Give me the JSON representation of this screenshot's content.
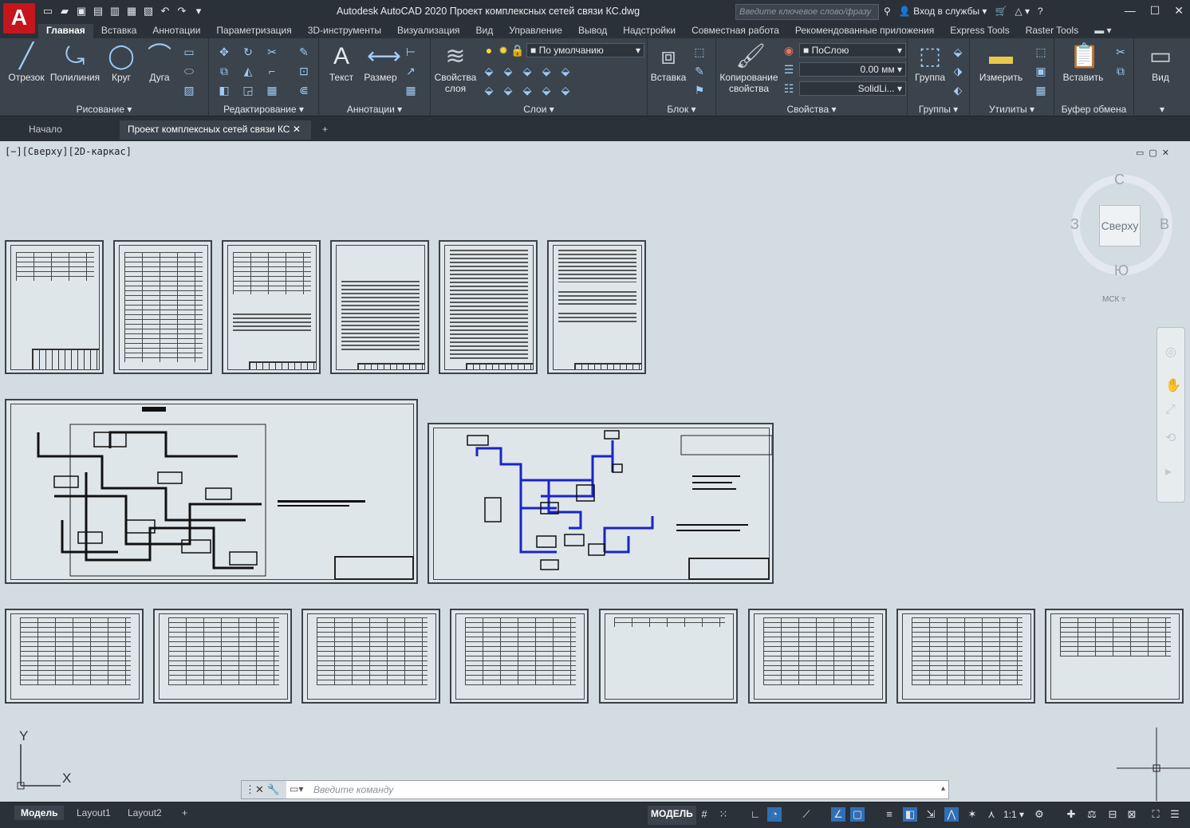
{
  "app": {
    "title": "Autodesk AutoCAD 2020   Проект комплексных сетей связи КС.dwg",
    "logo": "A",
    "search_placeholder": "Введите ключевое слово/фразу",
    "signin": "Вход в службы",
    "help": "?"
  },
  "qat": [
    "new-icon",
    "open-icon",
    "save-icon",
    "saveas-icon",
    "publish-icon",
    "plot-icon",
    "print-icon",
    "undo-icon",
    "redo-icon",
    "dropdown-icon"
  ],
  "menu_tabs": [
    "Главная",
    "Вставка",
    "Аннотации",
    "Параметризация",
    "3D-инструменты",
    "Визуализация",
    "Вид",
    "Управление",
    "Вывод",
    "Надстройки",
    "Совместная работа",
    "Рекомендованные приложения",
    "Express Tools",
    "Raster Tools"
  ],
  "ribbon": {
    "draw": {
      "title": "Рисование",
      "line": "Отрезок",
      "polyline": "Полилиния",
      "circle": "Круг",
      "arc": "Дуга"
    },
    "modify": {
      "title": "Редактирование"
    },
    "annot": {
      "title": "Аннотации",
      "text": "Текст",
      "dim": "Размер"
    },
    "layers": {
      "title": "Слои",
      "props": "Свойства\nслоя",
      "current": "По умолчанию"
    },
    "block": {
      "title": "Блок",
      "insert": "Вставка"
    },
    "match": {
      "label": "Копирование\nсвойства"
    },
    "props": {
      "title": "Свойства",
      "color": "ПоСлою",
      "lw": "0.00 мм",
      "lt": "SolidLi..."
    },
    "groups": {
      "title": "Группы",
      "group": "Группа"
    },
    "utils": {
      "title": "Утилиты",
      "measure": "Измерить"
    },
    "clip": {
      "title": "Буфер обмена",
      "paste": "Вставить"
    },
    "view": {
      "title": "Вид"
    }
  },
  "doc_tabs": {
    "start": "Начало",
    "file": "Проект комплексных сетей связи КС"
  },
  "viewport": {
    "label": "[−][Сверху][2D-каркас]"
  },
  "viewcube": {
    "top": "Сверху",
    "n": "С",
    "s": "Ю",
    "w": "З",
    "e": "В",
    "ucs": "МСК"
  },
  "ucs": {
    "x": "X",
    "y": "Y"
  },
  "command": {
    "placeholder": "Введите  команду"
  },
  "layout_tabs": [
    "Модель",
    "Layout1",
    "Layout2"
  ],
  "status": {
    "model": "МОДЕЛЬ",
    "scale": "1:1"
  },
  "colors": {
    "accent": "#c4161c",
    "canvas": "#d3dce1",
    "blue_route": "#1a24c8"
  }
}
